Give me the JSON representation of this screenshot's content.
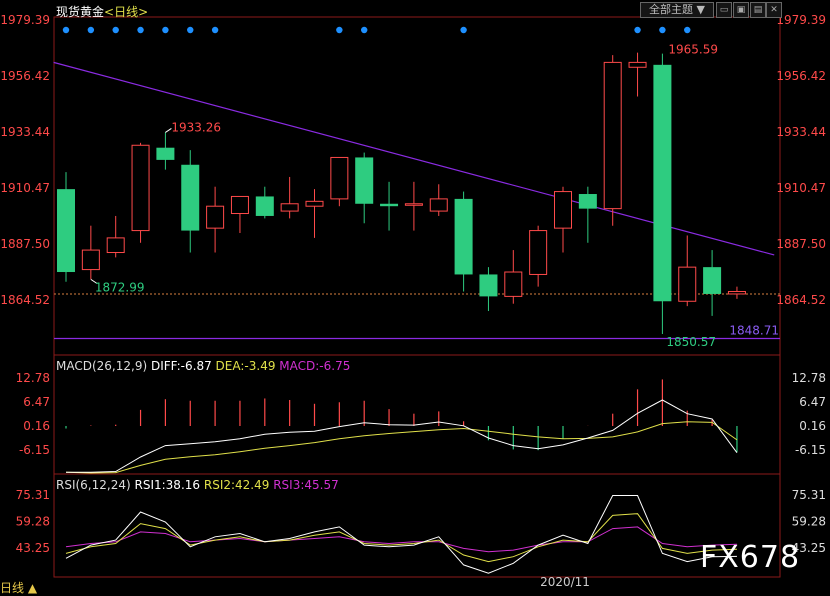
{
  "header": {
    "symbol": "现货黄金",
    "period": "<日线>",
    "theme_button": "全部主题",
    "window_buttons": [
      "minimize-icon",
      "maximize-icon",
      "close-icon"
    ]
  },
  "footer": {
    "period_label": "日线 ▲"
  },
  "watermark": "FX678",
  "colors": {
    "up": "#ff4a4a",
    "down": "#2ecc80",
    "axis_red": "#ff4a4a",
    "trend": "#8a2be2",
    "diff": "#ffffff",
    "dea": "#e0e04a",
    "macd": "#d030d0"
  },
  "chart_data": [
    {
      "type": "candlestick",
      "title": "现货黄金<日线>",
      "y_ticks": [
        1979.39,
        1956.42,
        1933.44,
        1910.47,
        1887.5,
        1864.52
      ],
      "ylim": [
        1845,
        1984
      ],
      "x_label": "2020/11",
      "candles": [
        {
          "o": 1910,
          "h": 1917,
          "l": 1872,
          "c": 1876
        },
        {
          "o": 1877,
          "h": 1895,
          "l": 1873,
          "c": 1885
        },
        {
          "o": 1884,
          "h": 1899,
          "l": 1882,
          "c": 1890
        },
        {
          "o": 1893,
          "h": 1929,
          "l": 1888,
          "c": 1928
        },
        {
          "o": 1927,
          "h": 1933.26,
          "l": 1918,
          "c": 1922
        },
        {
          "o": 1920,
          "h": 1926,
          "l": 1884,
          "c": 1893
        },
        {
          "o": 1894,
          "h": 1911,
          "l": 1884,
          "c": 1903
        },
        {
          "o": 1900,
          "h": 1907,
          "l": 1892,
          "c": 1907
        },
        {
          "o": 1907,
          "h": 1911,
          "l": 1898,
          "c": 1899
        },
        {
          "o": 1901,
          "h": 1915,
          "l": 1898,
          "c": 1904
        },
        {
          "o": 1903,
          "h": 1910,
          "l": 1890,
          "c": 1905
        },
        {
          "o": 1906,
          "h": 1923,
          "l": 1903,
          "c": 1923
        },
        {
          "o": 1923,
          "h": 1925,
          "l": 1896,
          "c": 1904
        },
        {
          "o": 1904,
          "h": 1913,
          "l": 1893,
          "c": 1903
        },
        {
          "o": 1904,
          "h": 1913,
          "l": 1893,
          "c": 1904
        },
        {
          "o": 1901,
          "h": 1912,
          "l": 1899,
          "c": 1906
        },
        {
          "o": 1906,
          "h": 1909,
          "l": 1868,
          "c": 1875
        },
        {
          "o": 1875,
          "h": 1878,
          "l": 1860,
          "c": 1866
        },
        {
          "o": 1866,
          "h": 1885,
          "l": 1863,
          "c": 1876
        },
        {
          "o": 1875,
          "h": 1895,
          "l": 1870,
          "c": 1893
        },
        {
          "o": 1894,
          "h": 1911,
          "l": 1884,
          "c": 1909
        },
        {
          "o": 1908,
          "h": 1911,
          "l": 1888,
          "c": 1902
        },
        {
          "o": 1902,
          "h": 1965,
          "l": 1895,
          "c": 1962
        },
        {
          "o": 1960,
          "h": 1966,
          "l": 1948,
          "c": 1962
        },
        {
          "o": 1961,
          "h": 1965.59,
          "l": 1850.57,
          "c": 1864
        },
        {
          "o": 1864,
          "h": 1891,
          "l": 1862,
          "c": 1878
        },
        {
          "o": 1878,
          "h": 1885,
          "l": 1858,
          "c": 1867
        },
        {
          "o": 1867,
          "h": 1870,
          "l": 1865,
          "c": 1868
        }
      ],
      "annotations": {
        "high_left": "1933.26",
        "low_left": "1872.99",
        "high": "1965.59",
        "low": "1850.57",
        "support": "1848.71"
      },
      "trendline": {
        "from": {
          "i": -0.5,
          "y": 1962
        },
        "to": {
          "i": 28.5,
          "y": 1883
        }
      },
      "support_level": 1848.71,
      "reference_level": 1867,
      "dots_at": [
        0,
        1,
        2,
        3,
        4,
        5,
        6,
        11,
        12,
        16,
        23,
        24,
        25
      ]
    },
    {
      "type": "macd",
      "label": "MACD(26,12,9)",
      "diff_label": "DIFF:-6.87",
      "dea_label": "DEA:-3.49",
      "macd_label": "MACD:-6.75",
      "y_ticks": [
        12.78,
        6.47,
        0.16,
        -6.15
      ],
      "ylim": [
        -12.5,
        13.5
      ],
      "diff": [
        -12,
        -12,
        -11.8,
        -8,
        -5,
        -4.5,
        -4,
        -3.2,
        -2,
        -1.5,
        -1.2,
        0,
        1,
        0.5,
        0.4,
        1.2,
        0.2,
        -3,
        -5,
        -5.8,
        -4.8,
        -3,
        -1,
        3.5,
        7,
        3.4,
        2,
        -6.87
      ],
      "dea": [
        -12,
        -12.2,
        -12.1,
        -10.2,
        -8.6,
        -7.9,
        -7.4,
        -6.6,
        -5.7,
        -5,
        -4.2,
        -3.2,
        -2.4,
        -1.8,
        -1.3,
        -0.8,
        -0.5,
        -1.2,
        -2,
        -2.7,
        -3.2,
        -3.1,
        -2.7,
        -1.4,
        0.8,
        1.3,
        1.1,
        -3.49
      ],
      "macd": [
        -0.5,
        0.3,
        0.5,
        4.4,
        7.2,
        6.8,
        6.8,
        6.8,
        7.4,
        7,
        6,
        6.4,
        6.8,
        4.6,
        3.4,
        4,
        1.4,
        -3.6,
        -6,
        -6.2,
        -3.2,
        0.2,
        3.4,
        9.8,
        12.4,
        4.2,
        1.8,
        -6.75
      ]
    },
    {
      "type": "rsi",
      "label": "RSI(6,12,24)",
      "rsi1_label": "RSI1:38.16",
      "rsi2_label": "RSI2:42.49",
      "rsi3_label": "RSI3:45.57",
      "y_ticks": [
        75.31,
        59.28,
        43.25
      ],
      "ylim": [
        25,
        80
      ],
      "rsi1": [
        37,
        45,
        48,
        65,
        59,
        44,
        50,
        52,
        47,
        49,
        53,
        56,
        45,
        44,
        45,
        50,
        33,
        28,
        34,
        45,
        51,
        46,
        75,
        75,
        40,
        35,
        38,
        38.16
      ],
      "rsi2": [
        40,
        44,
        46,
        58,
        55,
        45,
        48,
        50,
        47,
        48,
        51,
        53,
        46,
        45,
        46,
        48,
        39,
        35,
        38,
        44,
        48,
        47,
        63,
        64,
        43,
        40,
        42,
        42.49
      ],
      "rsi3": [
        44,
        46,
        47,
        53,
        52,
        47,
        48,
        49,
        47,
        48,
        49,
        50,
        47,
        46,
        47,
        47,
        43,
        41,
        42,
        45,
        47,
        47,
        55,
        56,
        46,
        44,
        45,
        45.57
      ]
    }
  ]
}
